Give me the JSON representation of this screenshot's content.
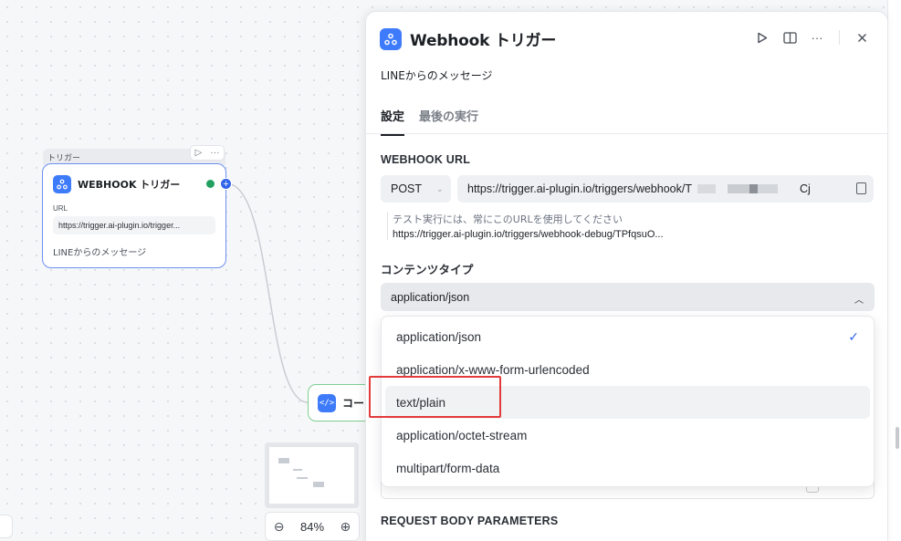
{
  "canvas": {
    "trigger_tag": "トリガー",
    "webhook_node": {
      "title": "WEBHOOK トリガー",
      "url_label": "URL",
      "url": "https://trigger.ai-plugin.io/trigger...",
      "description": "LINEからのメッセージ"
    },
    "code_node": {
      "title": "コー",
      "icon_label": "</>"
    },
    "zoom": {
      "level": "84%",
      "zoom_out": "⊖",
      "zoom_in": "⊕"
    }
  },
  "panel": {
    "title": "Webhook トリガー",
    "subtitle": "LINEからのメッセージ",
    "tabs": [
      {
        "label": "設定",
        "active": true
      },
      {
        "label": "最後の実行",
        "active": false
      }
    ],
    "webhook_url": {
      "label": "WEBHOOK URL",
      "method": "POST",
      "url": "https://trigger.ai-plugin.io/triggers/webhook/T",
      "url_tail": "Cj",
      "hint": "テスト実行には、常にこのURLを使用してください",
      "debug_url": "https://trigger.ai-plugin.io/triggers/webhook-debug/TPfqsuO..."
    },
    "content_type": {
      "label": "コンテンツタイプ",
      "selected": "application/json",
      "options": [
        "application/json",
        "application/x-www-form-urlencoded",
        "text/plain",
        "application/octet-stream",
        "multipart/form-data"
      ],
      "hovered_option": "text/plain"
    },
    "request_body_label": "REQUEST BODY PARAMETERS"
  },
  "colors": {
    "accent": "#3e7bfa",
    "success": "#22a060",
    "highlight": "#e23a3a",
    "check": "#2f64e8"
  }
}
